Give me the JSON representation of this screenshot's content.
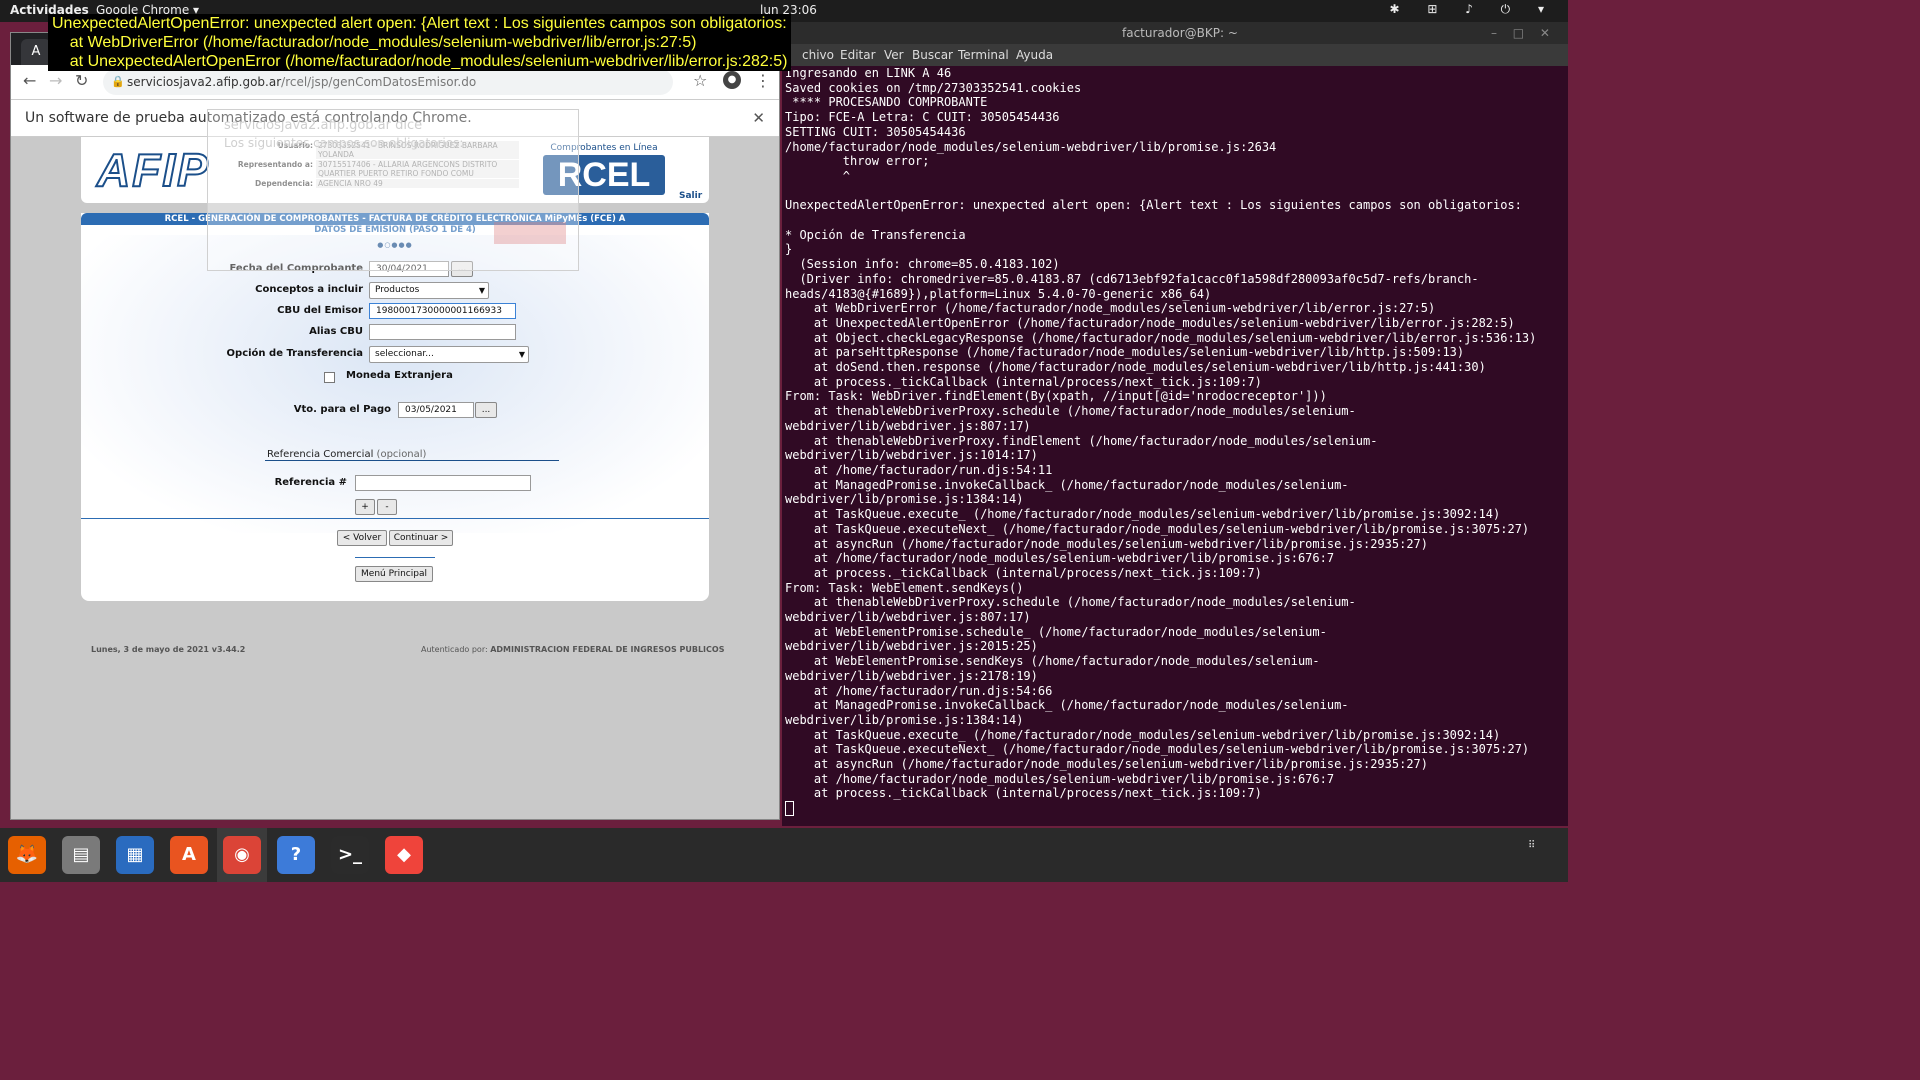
{
  "topbar": {
    "activities": "Actividades",
    "app_name": "Google Chrome ▾",
    "clock": "lun 23:06",
    "system_icons": "✱ ⊞ ♪ ⏻ ▾"
  },
  "overlay_error": {
    "line1": "UnexpectedAlertOpenError: unexpected alert open: {Alert text : Los siguientes campos son obligatorios:",
    "line2": "    at WebDriverError (/home/facturador/node_modules/selenium-webdriver/lib/error.js:27:5)",
    "line3": "    at UnexpectedAlertOpenError (/home/facturador/node_modules/selenium-webdriver/lib/error.js:282:5)"
  },
  "chrome": {
    "tab_glyph": "A",
    "url_domain": "serviciosjava2.afip.gob.ar",
    "url_path": "/rcel/jsp/genComDatosEmisor.do",
    "infobar_message": "Un software de prueba automatizado está controlando Chrome.",
    "infobar_close": "✕"
  },
  "ghost_alert": {
    "title": "serviciosjava2.afip.gob.ar dice",
    "message": "Los siguientes campos son obligatorios:"
  },
  "afip": {
    "logo_text": "AFIP",
    "usuario_label": "Usuario:",
    "usuario_value": "27303352541 - BRINSOS RODRIGUEZ BARBARA YOLANDA",
    "representando_label": "Representando a:",
    "representando_value": "30715517406 - ALLARIA ARGENCONS DISTRITO QUARTIER PUERTO RETIRO FONDO COMU",
    "dependencia_label": "Dependencia:",
    "dependencia_value": "AGENCIA NRO 49",
    "rcel_caption": "Comprobantes en Línea",
    "rcel_logo": "RCEL",
    "salir": "Salir"
  },
  "form": {
    "title_line1": "RCEL - GENERACIÓN DE COMPROBANTES - FACTURA DE CRÉDITO ELECTRÓNICA MiPyMEs (FCE) A",
    "title_line2": "DATOS DE EMISIÓN (PASO 1 DE 4)",
    "steps": "●○●●●",
    "fecha_label": "Fecha del Comprobante",
    "fecha_value": "30/04/2021",
    "dots_button": "...",
    "conceptos_label": "Conceptos a incluir",
    "conceptos_value": "Productos",
    "cbu_label": "CBU del Emisor",
    "cbu_value": "1980001730000001166933",
    "alias_label": "Alias CBU",
    "alias_value": "",
    "opcion_label": "Opción de Transferencia",
    "opcion_value": "seleccionar...",
    "moneda_label": "Moneda Extranjera",
    "vto_label": "Vto. para el Pago",
    "vto_value": "03/05/2021",
    "ref_title": "Referencia Comercial",
    "ref_optional": "(opcional)",
    "ref_label": "Referencia #",
    "ref_value": "",
    "plus": "+",
    "minus": "-",
    "volver": "< Volver",
    "continuar": "Continuar >",
    "menu_principal": "Menú Principal"
  },
  "page_footer": {
    "left": "Lunes, 3 de mayo de 2021 v3.44.2",
    "right_prefix": "Autenticado por:",
    "right_org": "ADMINISTRACION FEDERAL DE INGRESOS PUBLICOS"
  },
  "terminal": {
    "title": "facturador@BKP: ~",
    "window_buttons": "– □ ✕",
    "menu": [
      "chivo",
      "Editar",
      "Ver",
      "Buscar",
      "Terminal",
      "Ayuda"
    ],
    "output": "Ingresando en LINK A 46\nSaved cookies on /tmp/27303352541.cookies\n **** PROCESANDO COMPROBANTE\nTipo: FCE-A Letra: C CUIT: 30505454436\nSETTING CUIT: 30505454436\n/home/facturador/node_modules/selenium-webdriver/lib/promise.js:2634\n        throw error;\n        ^\n\nUnexpectedAlertOpenError: unexpected alert open: {Alert text : Los siguientes campos son obligatorios:\n\n* Opción de Transferencia\n}\n  (Session info: chrome=85.0.4183.102)\n  (Driver info: chromedriver=85.0.4183.87 (cd6713ebf92fa1cacc0f1a598df280093af0c5d7-refs/branch-heads/4183@{#1689}),platform=Linux 5.4.0-70-generic x86_64)\n    at WebDriverError (/home/facturador/node_modules/selenium-webdriver/lib/error.js:27:5)\n    at UnexpectedAlertOpenError (/home/facturador/node_modules/selenium-webdriver/lib/error.js:282:5)\n    at Object.checkLegacyResponse (/home/facturador/node_modules/selenium-webdriver/lib/error.js:536:13)\n    at parseHttpResponse (/home/facturador/node_modules/selenium-webdriver/lib/http.js:509:13)\n    at doSend.then.response (/home/facturador/node_modules/selenium-webdriver/lib/http.js:441:30)\n    at process._tickCallback (internal/process/next_tick.js:109:7)\nFrom: Task: WebDriver.findElement(By(xpath, //input[@id='nrodocreceptor']))\n    at thenableWebDriverProxy.schedule (/home/facturador/node_modules/selenium-webdriver/lib/webdriver.js:807:17)\n    at thenableWebDriverProxy.findElement (/home/facturador/node_modules/selenium-webdriver/lib/webdriver.js:1014:17)\n    at /home/facturador/run.djs:54:11\n    at ManagedPromise.invokeCallback_ (/home/facturador/node_modules/selenium-webdriver/lib/promise.js:1384:14)\n    at TaskQueue.execute_ (/home/facturador/node_modules/selenium-webdriver/lib/promise.js:3092:14)\n    at TaskQueue.executeNext_ (/home/facturador/node_modules/selenium-webdriver/lib/promise.js:3075:27)\n    at asyncRun (/home/facturador/node_modules/selenium-webdriver/lib/promise.js:2935:27)\n    at /home/facturador/node_modules/selenium-webdriver/lib/promise.js:676:7\n    at process._tickCallback (internal/process/next_tick.js:109:7)\nFrom: Task: WebElement.sendKeys()\n    at thenableWebDriverProxy.schedule (/home/facturador/node_modules/selenium-webdriver/lib/webdriver.js:807:17)\n    at WebElementPromise.schedule_ (/home/facturador/node_modules/selenium-webdriver/lib/webdriver.js:2015:25)\n    at WebElementPromise.sendKeys (/home/facturador/node_modules/selenium-webdriver/lib/webdriver.js:2178:19)\n    at /home/facturador/run.djs:54:66\n    at ManagedPromise.invokeCallback_ (/home/facturador/node_modules/selenium-webdriver/lib/promise.js:1384:14)\n    at TaskQueue.execute_ (/home/facturador/node_modules/selenium-webdriver/lib/promise.js:3092:14)\n    at TaskQueue.executeNext_ (/home/facturador/node_modules/selenium-webdriver/lib/promise.js:3075:27)\n    at asyncRun (/home/facturador/node_modules/selenium-webdriver/lib/promise.js:2935:27)\n    at /home/facturador/node_modules/selenium-webdriver/lib/promise.js:676:7\n    at process._tickCallback (internal/process/next_tick.js:109:7)\n"
  },
  "dock": {
    "items": [
      {
        "name": "firefox",
        "glyph": "🦊",
        "color": "#e66000"
      },
      {
        "name": "files",
        "glyph": "▤",
        "color": "#7a7a7a"
      },
      {
        "name": "writer",
        "glyph": "▦",
        "color": "#2a6bbf"
      },
      {
        "name": "software",
        "glyph": "A",
        "color": "#e95420"
      },
      {
        "name": "chrome",
        "glyph": "◉",
        "color": "#db4437"
      },
      {
        "name": "help",
        "glyph": "?",
        "color": "#3d7bd9"
      },
      {
        "name": "terminal",
        "glyph": ">_",
        "color": "#2b2b2b"
      },
      {
        "name": "anydesk",
        "glyph": "◆",
        "color": "#ef443b"
      }
    ],
    "apps_grid": "⠿"
  }
}
